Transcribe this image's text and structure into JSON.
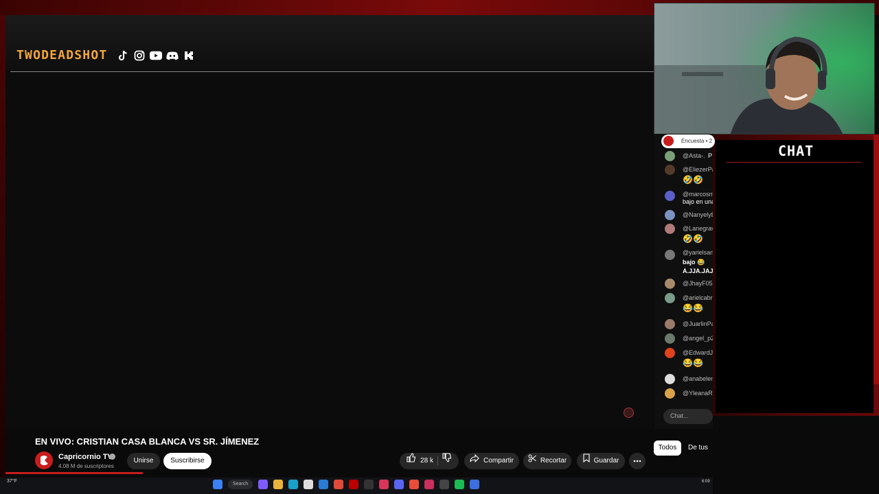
{
  "brand": {
    "name": "TWODEADSHOT",
    "accent": "#f3a63a"
  },
  "social_icons": [
    "tiktok-icon",
    "instagram-icon",
    "youtube-icon",
    "discord-icon",
    "kick-icon"
  ],
  "video": {
    "title": "EN VIVO: CRISTIAN CASA BLANCA VS SR. JÍMENEZ",
    "channel": "Capricornio TV",
    "subscribers": "4.08 M de suscriptores",
    "join_label": "Unirse",
    "subscribe_label": "Suscribirse",
    "likes": "28 k",
    "share_label": "Compartir",
    "clip_label": "Recortar",
    "save_label": "Guardar"
  },
  "chat": {
    "heading": "CHAT",
    "poll_label": "Encuesta • 2",
    "messages": [
      {
        "user": "@Asta-.",
        "text": "P"
      },
      {
        "user": "@EliezerPa",
        "text": "🤣🤣"
      },
      {
        "user": "@marcosm",
        "text": "bajo en una"
      },
      {
        "user": "@NanyelyE",
        "text": ""
      },
      {
        "user": "@Lanegrav",
        "text": "🤣🤣"
      },
      {
        "user": "@yarielsan",
        "text": "bajo 😂 A.JJA.JAJA"
      },
      {
        "user": "@JhayF05",
        "text": ""
      },
      {
        "user": "@arielcabr",
        "text": "😂😂"
      },
      {
        "user": "@JuarlinPa",
        "text": ""
      },
      {
        "user": "@angel_p2",
        "text": ""
      },
      {
        "user": "@EdwardJe",
        "text": "😂😂"
      },
      {
        "user": "@anabelen",
        "text": ""
      },
      {
        "user": "@YleanaRo",
        "text": ""
      }
    ],
    "input_placeholder": "Chat...",
    "tab_all": "Todos",
    "tab_subs": "De tus"
  },
  "taskbar": {
    "weather": "37°F",
    "search": "Search",
    "clock": "6:09"
  }
}
